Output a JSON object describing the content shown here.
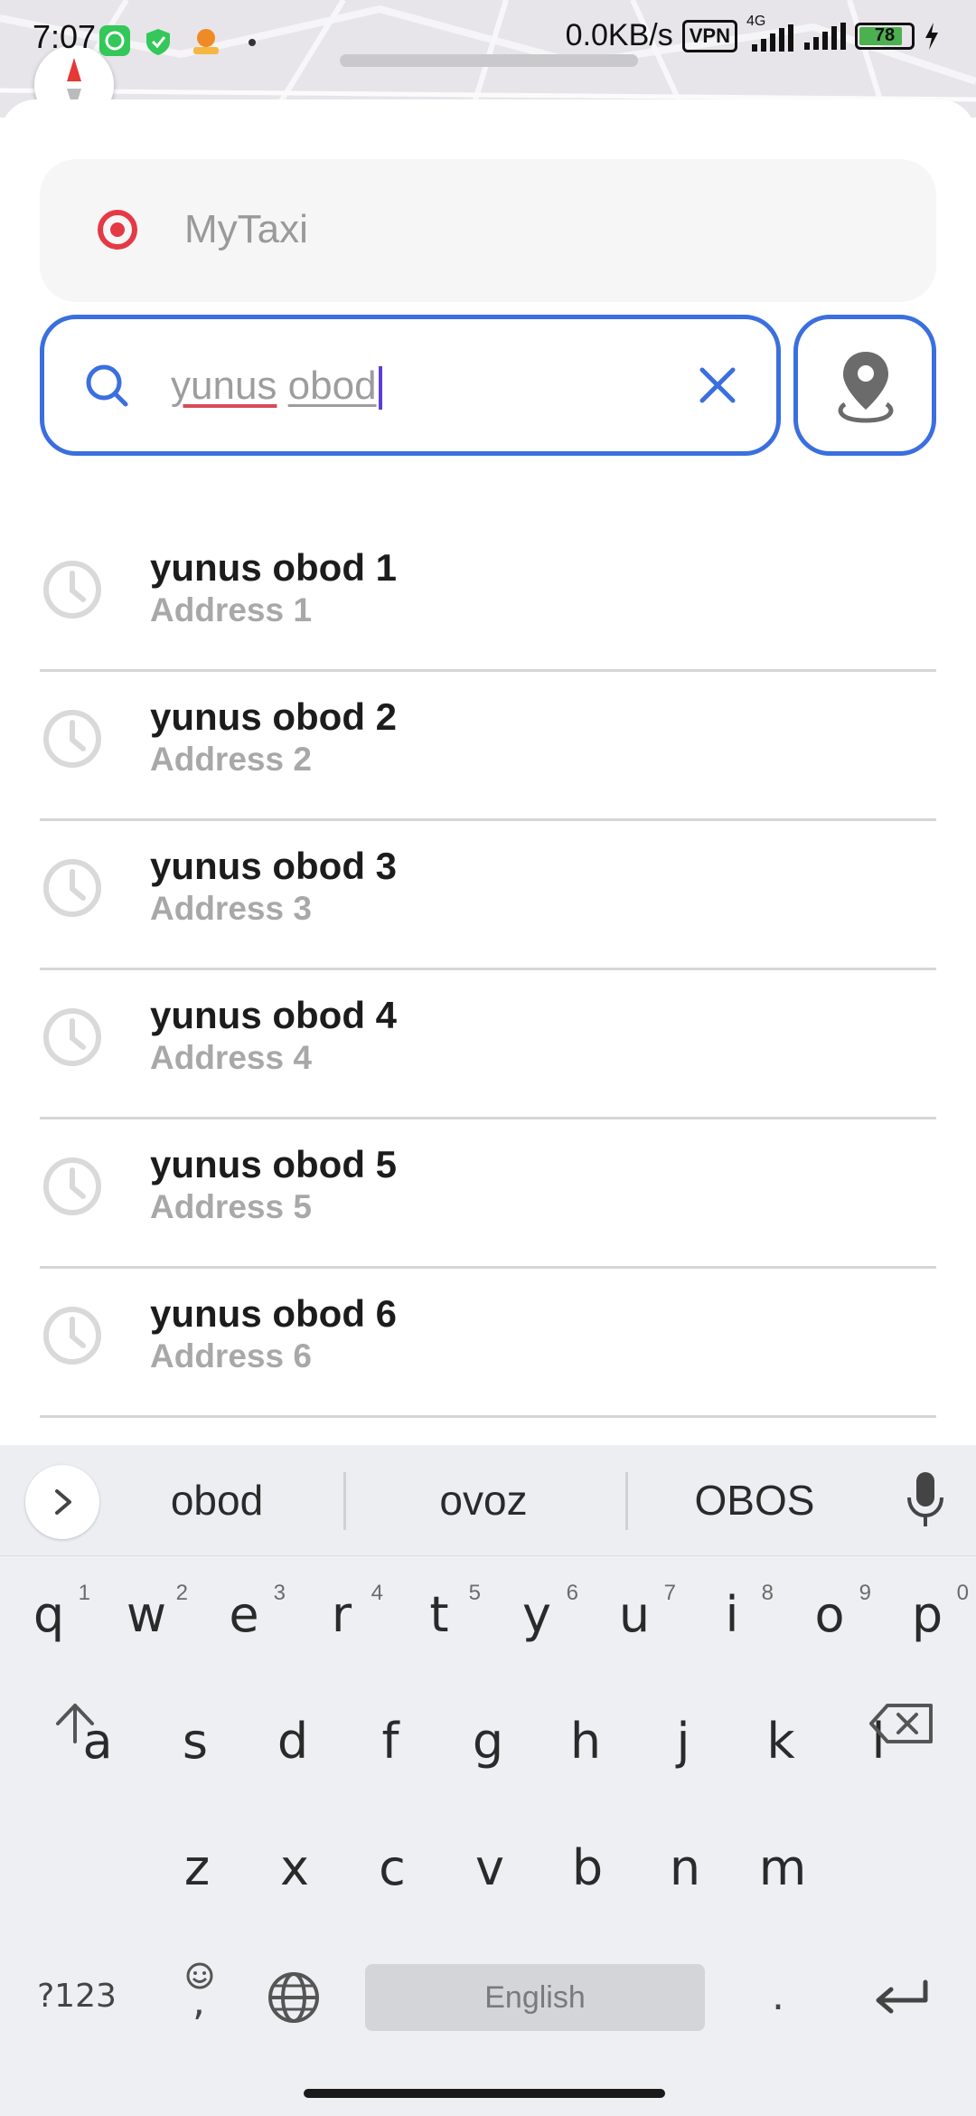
{
  "status_bar": {
    "time": "7:07",
    "network_speed": "0.0KB/s",
    "vpn_label": "VPN",
    "network_type": "4G",
    "battery": "78",
    "icons": [
      "face-app-icon",
      "shield-icon",
      "notification-app-icon",
      "dot-icon",
      "signal-icon",
      "signal-icon",
      "charging-icon"
    ]
  },
  "origin": {
    "label": "MyTaxi",
    "icon": "target-icon",
    "icon_color": "#e53946"
  },
  "search": {
    "word1": "yunus",
    "word2": "obod",
    "accent_color": "#3b6fe0",
    "icon": "search-icon",
    "clear_icon": "close-icon",
    "map_pick_icon": "location-pin-icon"
  },
  "results": [
    {
      "title": "yunus obod 1",
      "subtitle": "Address 1",
      "icon": "clock-icon"
    },
    {
      "title": "yunus obod 2",
      "subtitle": "Address 2",
      "icon": "clock-icon"
    },
    {
      "title": "yunus obod 3",
      "subtitle": "Address 3",
      "icon": "clock-icon"
    },
    {
      "title": "yunus obod 4",
      "subtitle": "Address 4",
      "icon": "clock-icon"
    },
    {
      "title": "yunus obod 5",
      "subtitle": "Address 5",
      "icon": "clock-icon"
    },
    {
      "title": "yunus obod 6",
      "subtitle": "Address 6",
      "icon": "clock-icon"
    }
  ],
  "keyboard": {
    "suggestions": [
      "obod",
      "ovoz",
      "OBOS"
    ],
    "row1": [
      "q",
      "w",
      "e",
      "r",
      "t",
      "y",
      "u",
      "i",
      "o",
      "p"
    ],
    "row1_hints": [
      "1",
      "2",
      "3",
      "4",
      "5",
      "6",
      "7",
      "8",
      "9",
      "0"
    ],
    "row2": [
      "a",
      "s",
      "d",
      "f",
      "g",
      "h",
      "j",
      "k",
      "l"
    ],
    "row3": [
      "z",
      "x",
      "c",
      "v",
      "b",
      "n",
      "m"
    ],
    "symbols_key": "?123",
    "comma_key": ",",
    "space_label": "English",
    "period_key": ".",
    "icons": [
      "chevron-right-icon",
      "microphone-icon",
      "shift-icon",
      "backspace-icon",
      "emoji-icon",
      "globe-icon",
      "enter-icon"
    ]
  }
}
